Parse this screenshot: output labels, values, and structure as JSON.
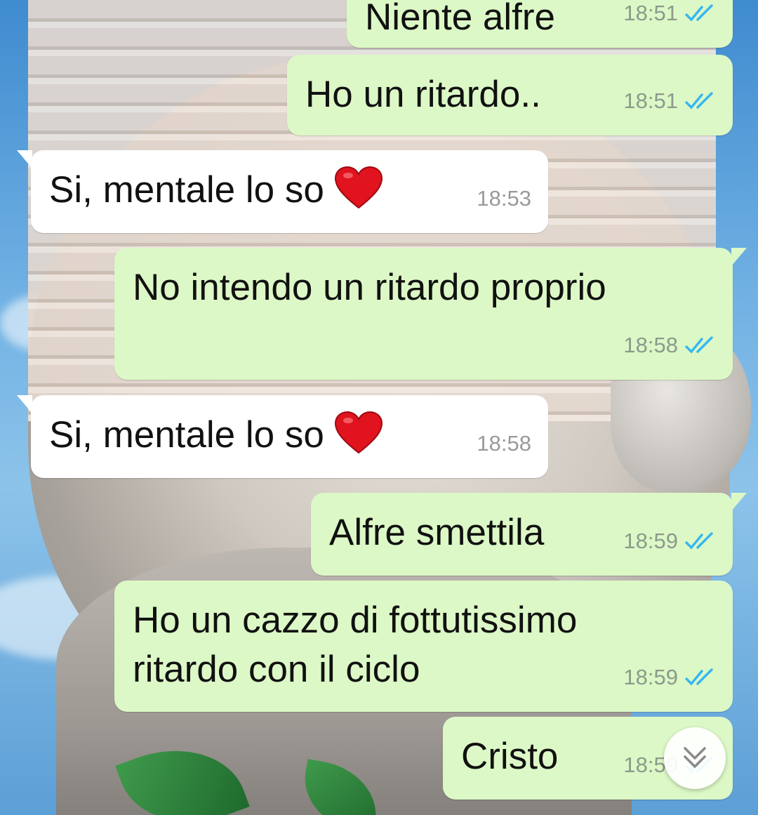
{
  "messages": [
    {
      "direction": "outgoing",
      "text": "Niente alfre",
      "time": "18:51",
      "status": "read"
    },
    {
      "direction": "outgoing",
      "text": "Ho un ritardo..",
      "time": "18:51",
      "status": "read"
    },
    {
      "direction": "incoming",
      "text": "Si, mentale lo so",
      "emoji": "red-heart",
      "time": "18:53"
    },
    {
      "direction": "outgoing",
      "text": "No intendo un ritardo proprio",
      "time": "18:58",
      "status": "read"
    },
    {
      "direction": "incoming",
      "text": "Si, mentale lo so",
      "emoji": "red-heart",
      "time": "18:58"
    },
    {
      "direction": "outgoing",
      "text": "Alfre smettila",
      "time": "18:59",
      "status": "read"
    },
    {
      "direction": "outgoing",
      "text": "Ho un cazzo di fottutissimo\nritardo con il ciclo",
      "time": "18:59",
      "status": "read"
    },
    {
      "direction": "outgoing",
      "text": "Cristo",
      "time": "18:59",
      "status": "read"
    }
  ],
  "colors": {
    "outgoing_bubble": "#dcf8c6",
    "incoming_bubble": "#ffffff",
    "read_ticks": "#34b7f1",
    "timestamp": "#8c9a8c"
  },
  "icons": {
    "read_receipt": "double-check-icon",
    "scroll_down": "chevron-double-down-icon",
    "emoji": "red-heart-icon"
  }
}
